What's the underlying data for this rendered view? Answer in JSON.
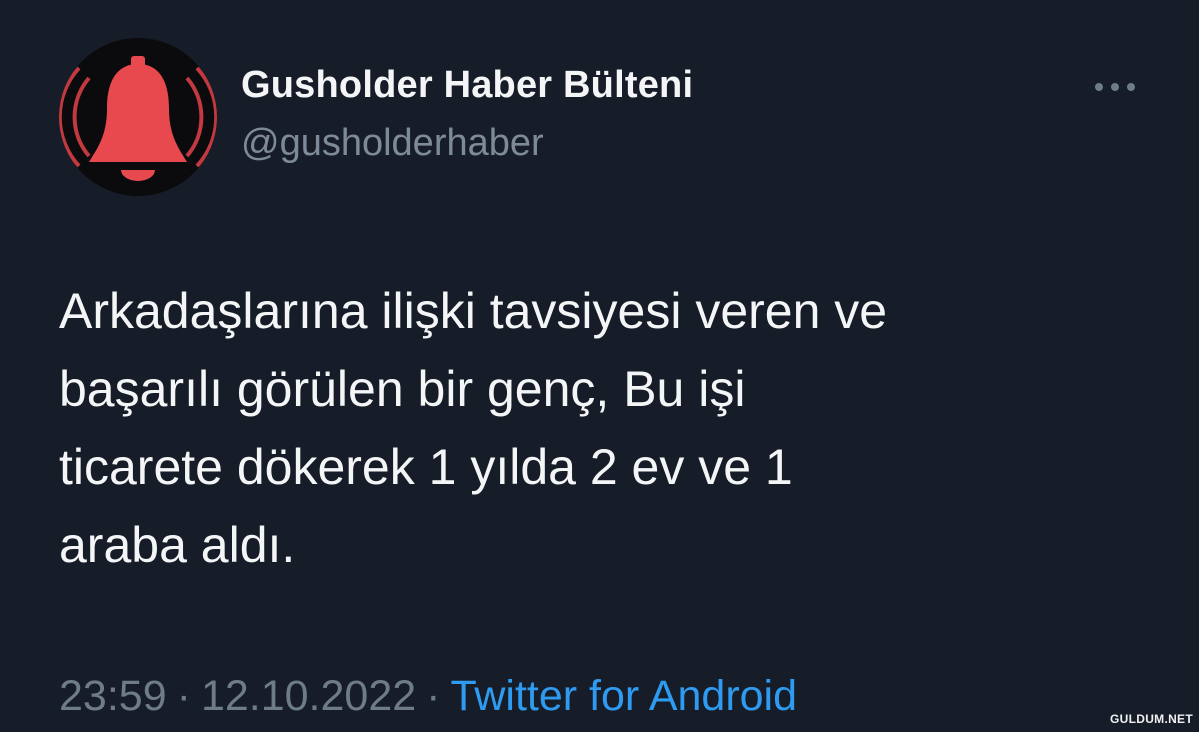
{
  "account": {
    "display_name": "Gusholder Haber Bülteni",
    "handle": "@gusholderhaber",
    "avatar_icon": "bell-icon"
  },
  "tweet": {
    "lines": [
      "Arkadaşlarına ilişki tavsiyesi veren ve",
      "başarılı görülen bir genç, Bu işi",
      "ticarete dökerek 1 yılda 2 ev ve 1",
      "araba aldı."
    ]
  },
  "meta": {
    "time": "23:59",
    "separator": "·",
    "date": "12.10.2022",
    "source": "Twitter for Android"
  },
  "icons": {
    "more": "more-options-icon"
  },
  "watermark": {
    "text": "GULDUM.NET"
  },
  "colors": {
    "background": "#161d28",
    "text": "#f4f5f6",
    "muted": "#7d8a97",
    "link": "#2f9bf0",
    "avatar_bell": "#e8494f"
  }
}
